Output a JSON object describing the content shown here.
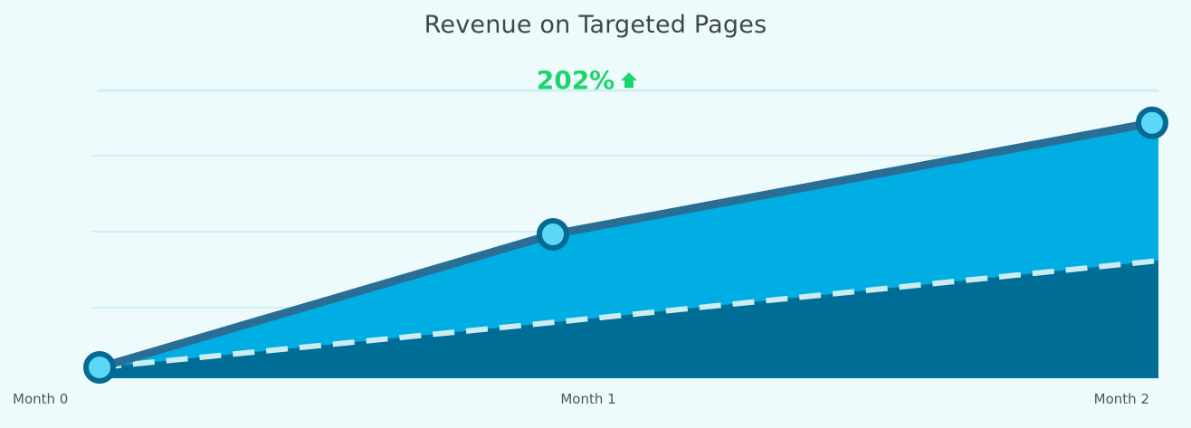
{
  "chart_data": {
    "type": "area",
    "title": "Revenue on Targeted Pages",
    "categories": [
      "Month 0",
      "Month 1",
      "Month 2"
    ],
    "series": [
      {
        "values": [
          0,
          148,
          272
        ]
      },
      {
        "values": [
          0,
          50,
          118
        ]
      }
    ],
    "ylim": [
      0,
      310
    ],
    "grid": true,
    "annotation": {
      "text": "202%",
      "direction": "up"
    },
    "colors": {
      "background": "#eefbfc",
      "gridline": "#cdeff6",
      "top_area": "#00aee3",
      "top_line": "#2a6e95",
      "bottom_area": "#006d96",
      "dashed_line": "#ccecf2",
      "marker_fill": "#5ad8f5",
      "marker_stroke": "#046a92",
      "annotation": "#1ed46d",
      "tick_label": "#4d565c"
    }
  }
}
